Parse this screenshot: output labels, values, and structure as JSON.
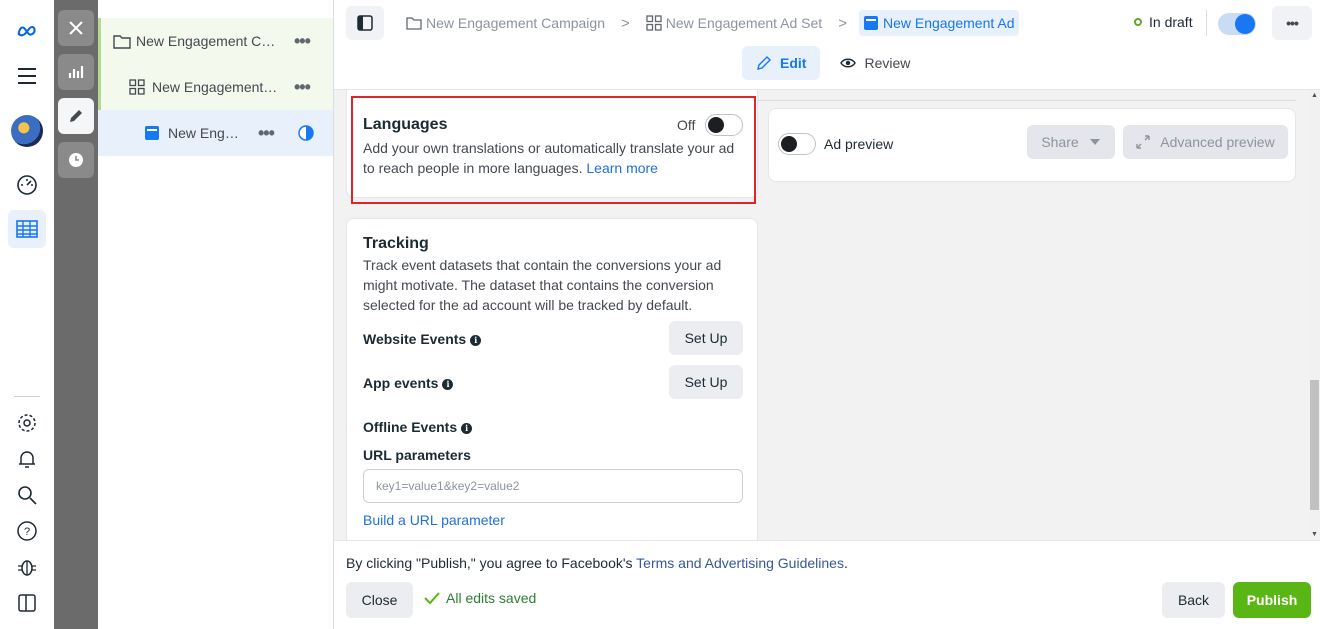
{
  "breadcrumbs": {
    "campaign": "New Engagement Campaign",
    "adset": "New Engagement Ad Set",
    "ad": "New Engagement Ad"
  },
  "status": {
    "label": "In draft",
    "toggle_on": true
  },
  "tabs": {
    "edit": "Edit",
    "review": "Review"
  },
  "tree": {
    "campaign": "New Engagement Ca...",
    "adset": "New Engagement ...",
    "ad": "New Engag..."
  },
  "languages": {
    "title": "Languages",
    "toggle_label": "Off",
    "description": "Add your own translations or automatically translate your ad to reach people in more languages.",
    "link": "Learn more"
  },
  "tracking": {
    "title": "Tracking",
    "description": "Track event datasets that contain the conversions your ad might motivate. The dataset that contains the conversion selected for the ad account will be tracked by default.",
    "website_events": "Website Events",
    "app_events": "App events",
    "offline_events": "Offline Events",
    "setup_label": "Set Up",
    "url_params_label": "URL parameters",
    "url_params_placeholder": "key1=value1&key2=value2",
    "build_link": "Build a URL parameter"
  },
  "preview": {
    "toggle_label": "Ad preview",
    "share": "Share",
    "advanced": "Advanced preview"
  },
  "footer": {
    "notice_prefix": "By clicking \"Publish,\" you agree to Facebook's ",
    "notice_link": "Terms and Advertising Guidelines",
    "notice_suffix": ".",
    "close": "Close",
    "saved": "All edits saved",
    "back": "Back",
    "publish": "Publish"
  },
  "colors": {
    "accent": "#1877f2",
    "publish": "#5ab614",
    "highlight": "#e0242c"
  }
}
